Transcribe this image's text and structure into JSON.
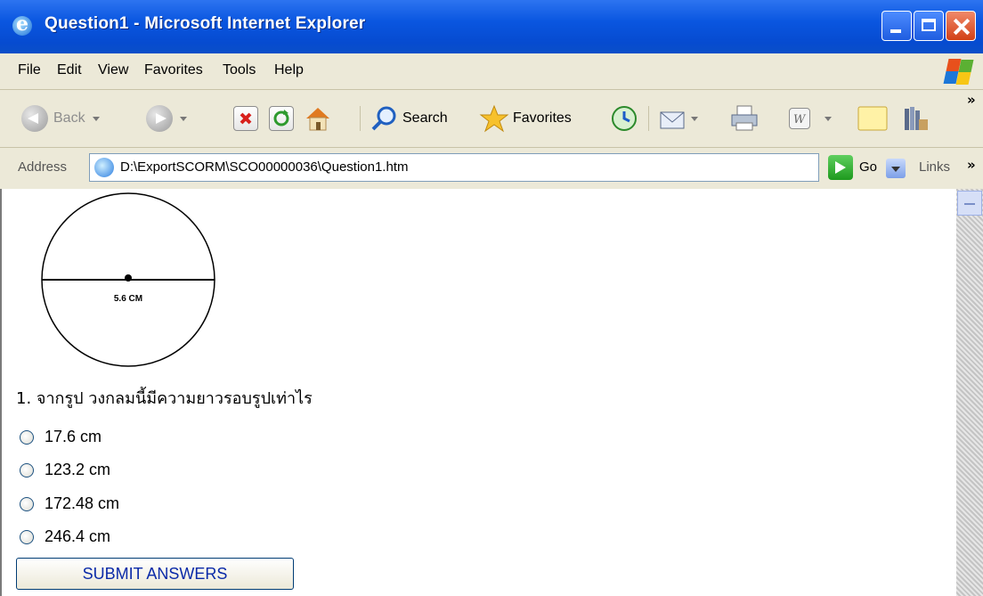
{
  "window": {
    "title": "Question1 - Microsoft Internet Explorer"
  },
  "menu": [
    "File",
    "Edit",
    "View",
    "Favorites",
    "Tools",
    "Help"
  ],
  "toolbar": {
    "back": "Back",
    "search": "Search",
    "favorites": "Favorites"
  },
  "address": {
    "label": "Address",
    "url": "D:\\ExportSCORM\\SCO00000036\\Question1.htm",
    "go": "Go",
    "links": "Links",
    "chevron": "»"
  },
  "figure": {
    "diameter_label": "5.6 CM"
  },
  "quiz": {
    "question": "1. จากรูป วงกลมนี้มีความยาวรอบรูปเท่าไร",
    "options": [
      "17.6 cm",
      "123.2 cm",
      "172.48 cm",
      "246.4 cm"
    ],
    "submit": "SUBMIT ANSWERS"
  }
}
